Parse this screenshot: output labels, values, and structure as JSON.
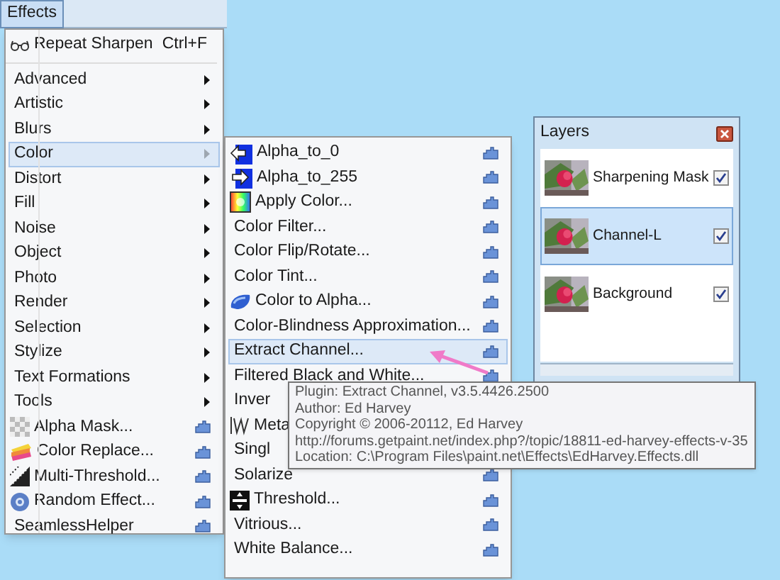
{
  "menu_bar": {
    "label": "Effects",
    "selected": true
  },
  "effects_menu": {
    "items": [
      {
        "kind": "command",
        "label": "Repeat Sharpen",
        "shortcut": "Ctrl+F",
        "selected": false
      },
      {
        "kind": "separator"
      },
      {
        "kind": "submenu",
        "label": "Advanced",
        "selected": false
      },
      {
        "kind": "submenu",
        "label": "Artistic",
        "selected": false
      },
      {
        "kind": "submenu",
        "label": "Blurs",
        "selected": false
      },
      {
        "kind": "submenu",
        "label": "Color",
        "selected": true
      },
      {
        "kind": "submenu",
        "label": "Distort",
        "selected": false
      },
      {
        "kind": "submenu",
        "label": "Fill",
        "selected": false
      },
      {
        "kind": "submenu",
        "label": "Noise",
        "selected": false
      },
      {
        "kind": "submenu",
        "label": "Object",
        "selected": false
      },
      {
        "kind": "submenu",
        "label": "Photo",
        "selected": false
      },
      {
        "kind": "submenu",
        "label": "Render",
        "selected": false
      },
      {
        "kind": "submenu",
        "label": "Selection",
        "selected": false
      },
      {
        "kind": "submenu",
        "label": "Stylize",
        "selected": false
      },
      {
        "kind": "submenu",
        "label": "Text Formations",
        "selected": false
      },
      {
        "kind": "submenu",
        "label": "Tools",
        "selected": false
      },
      {
        "kind": "plugin",
        "label": "Alpha Mask...",
        "selected": false
      },
      {
        "kind": "plugin",
        "label": "Color Replace...",
        "selected": false
      },
      {
        "kind": "plugin",
        "label": "Multi-Threshold...",
        "selected": false
      },
      {
        "kind": "plugin",
        "label": "Random Effect...",
        "selected": false
      },
      {
        "kind": "plugin",
        "label": "SeamlessHelper",
        "selected": false
      }
    ]
  },
  "color_submenu": {
    "items": [
      {
        "kind": "plugin",
        "label": "Alpha_to_0",
        "selected": false
      },
      {
        "kind": "plugin",
        "label": "Alpha_to_255",
        "selected": false
      },
      {
        "kind": "plugin",
        "label": "Apply Color...",
        "selected": false
      },
      {
        "kind": "plugin",
        "label": "Color Filter...",
        "selected": false
      },
      {
        "kind": "plugin",
        "label": "Color Flip/Rotate...",
        "selected": false
      },
      {
        "kind": "plugin",
        "label": "Color Tint...",
        "selected": false
      },
      {
        "kind": "plugin",
        "label": "Color to Alpha...",
        "selected": false
      },
      {
        "kind": "plugin",
        "label": "Color-Blindness Approximation...",
        "selected": false
      },
      {
        "kind": "plugin",
        "label": "Extract Channel...",
        "selected": true
      },
      {
        "kind": "plugin",
        "label": "Filtered Black and White...",
        "selected": false
      },
      {
        "kind": "plugin",
        "label": "Inver",
        "selected": false
      },
      {
        "kind": "plugin",
        "label": "Meta",
        "selected": false
      },
      {
        "kind": "plugin",
        "label": "Singl",
        "selected": false
      },
      {
        "kind": "plugin",
        "label": "Solarize",
        "selected": false
      },
      {
        "kind": "plugin",
        "label": "Threshold...",
        "selected": false
      },
      {
        "kind": "plugin",
        "label": "Vitrious...",
        "selected": false
      },
      {
        "kind": "plugin",
        "label": "White Balance...",
        "selected": false
      }
    ]
  },
  "tooltip": {
    "lines": [
      "Plugin: Extract Channel, v3.5.4426.2500",
      "Author: Ed Harvey",
      "Copyright ©  2006-20112, Ed Harvey",
      "http://forums.getpaint.net/index.php?/topic/18811-ed-harvey-effects-v-35",
      "Location: C:\\Program Files\\paint.net\\Effects\\EdHarvey.Effects.dll"
    ]
  },
  "layers_panel": {
    "title": "Layers",
    "layers": [
      {
        "name": "Sharpening Mask",
        "visible": true,
        "selected": false
      },
      {
        "name": "Channel-L",
        "visible": true,
        "selected": true
      },
      {
        "name": "Background",
        "visible": true,
        "selected": false
      }
    ]
  }
}
